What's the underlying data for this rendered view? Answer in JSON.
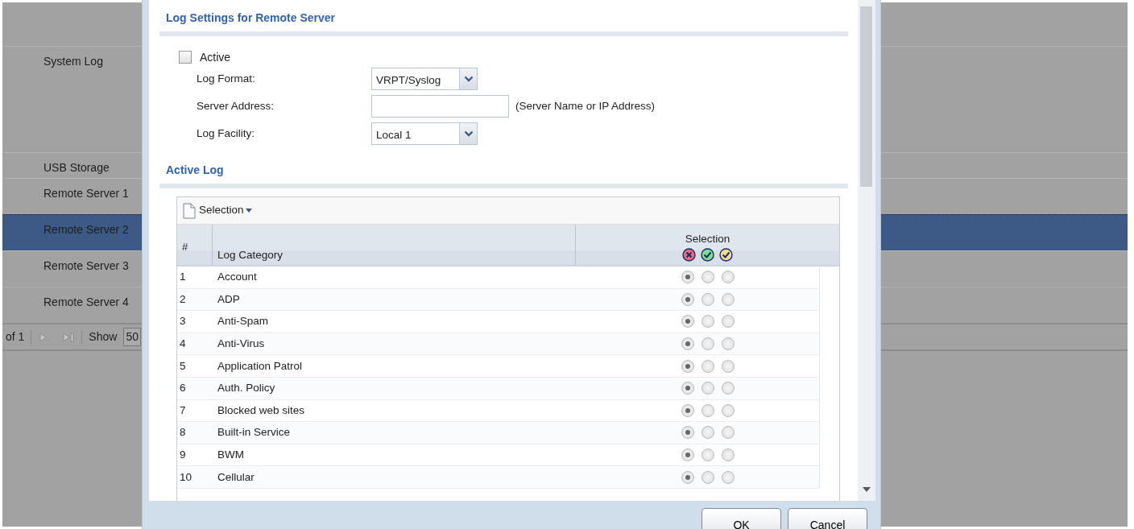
{
  "background_list": {
    "rows": [
      {
        "label": "System Log",
        "selected": false
      },
      {
        "label": "USB Storage",
        "selected": false
      },
      {
        "label": "Remote Server 1",
        "selected": false
      },
      {
        "label": "Remote Server 2",
        "selected": true
      },
      {
        "label": "Remote Server 3",
        "selected": false
      },
      {
        "label": "Remote Server 4",
        "selected": false
      }
    ],
    "pager": {
      "page_of": "of 1",
      "show_label": "Show",
      "page_size": "50"
    }
  },
  "dialog": {
    "section_title": "Log Settings for Remote Server",
    "active": {
      "label": "Active",
      "checked": false
    },
    "fields": [
      {
        "kind": "select",
        "label": "Log Format:",
        "value": "VRPT/Syslog"
      },
      {
        "kind": "input",
        "label": "Server Address:",
        "hint": "(Server Name or IP Address)"
      },
      {
        "kind": "select",
        "label": "Log Facility:",
        "value": "Local 1"
      }
    ],
    "active_log": {
      "title": "Active Log",
      "toolbar": {
        "label": "Selection"
      },
      "columns": [
        {
          "label": "#"
        },
        {
          "label": "Log Category"
        },
        {
          "label": "Selection"
        }
      ],
      "rows": [
        {
          "number": "1",
          "category": "Account",
          "radios": [
            {
              "selected": true
            },
            {
              "selected": false
            },
            {
              "selected": false
            }
          ]
        },
        {
          "number": "2",
          "category": "ADP",
          "radios": [
            {
              "selected": true
            },
            {
              "selected": false
            },
            {
              "selected": false
            }
          ]
        },
        {
          "number": "3",
          "category": "Anti-Spam",
          "radios": [
            {
              "selected": true
            },
            {
              "selected": false
            },
            {
              "selected": false
            }
          ]
        },
        {
          "number": "4",
          "category": "Anti-Virus",
          "radios": [
            {
              "selected": true
            },
            {
              "selected": false
            },
            {
              "selected": false
            }
          ]
        },
        {
          "number": "5",
          "category": "Application Patrol",
          "radios": [
            {
              "selected": true
            },
            {
              "selected": false
            },
            {
              "selected": false
            }
          ]
        },
        {
          "number": "6",
          "category": "Auth. Policy",
          "radios": [
            {
              "selected": true
            },
            {
              "selected": false
            },
            {
              "selected": false
            }
          ]
        },
        {
          "number": "7",
          "category": "Blocked web sites",
          "radios": [
            {
              "selected": true
            },
            {
              "selected": false
            },
            {
              "selected": false
            }
          ]
        },
        {
          "number": "8",
          "category": "Built-in Service",
          "radios": [
            {
              "selected": true
            },
            {
              "selected": false
            },
            {
              "selected": false
            }
          ]
        },
        {
          "number": "9",
          "category": "BWM",
          "radios": [
            {
              "selected": true
            },
            {
              "selected": false
            },
            {
              "selected": false
            }
          ]
        },
        {
          "number": "10",
          "category": "Cellular",
          "radios": [
            {
              "selected": true
            },
            {
              "selected": false
            },
            {
              "selected": false
            }
          ]
        }
      ]
    },
    "buttons": [
      {
        "label": "OK"
      },
      {
        "label": "Cancel"
      }
    ]
  }
}
